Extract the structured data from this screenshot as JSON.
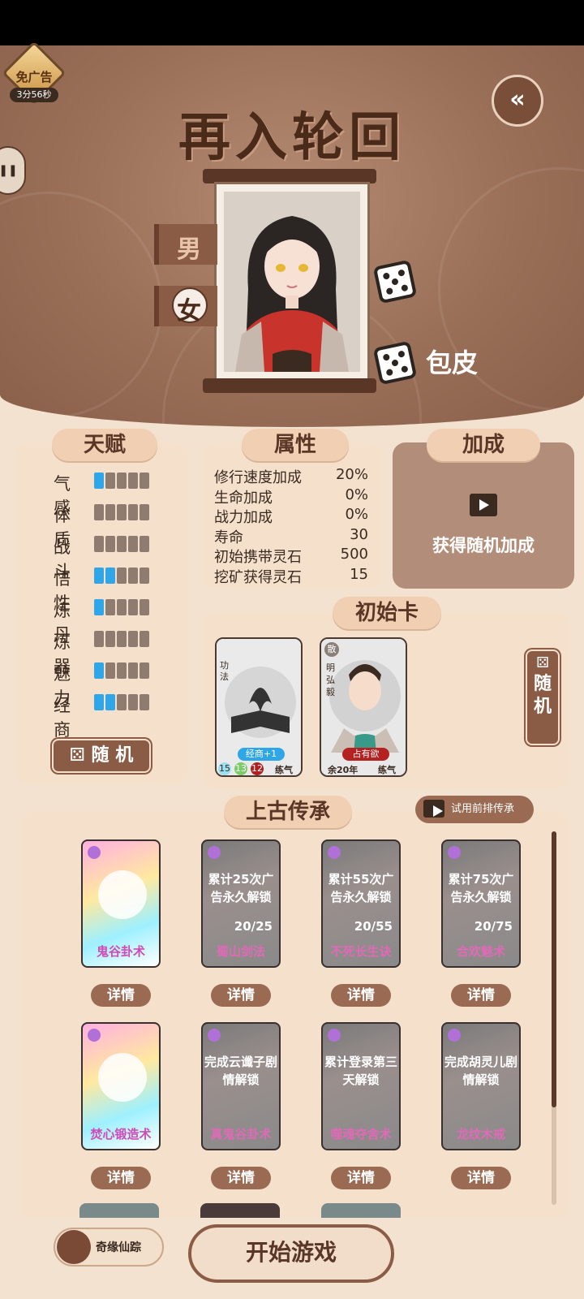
{
  "ad_badge": {
    "label": "免广告",
    "timer": "3分56秒"
  },
  "side_pill": {
    "label": "❚❚"
  },
  "back_button": {
    "glyph": "«"
  },
  "title": "再入轮回",
  "gender": {
    "male": "男",
    "female": "女",
    "selected": "female"
  },
  "skin_label": "包皮",
  "talent": {
    "tab": "天赋",
    "rows": [
      {
        "label": "气感",
        "level": 1
      },
      {
        "label": "体质",
        "level": 0
      },
      {
        "label": "战斗",
        "level": 0
      },
      {
        "label": "悟性",
        "level": 2
      },
      {
        "label": "炼丹",
        "level": 1
      },
      {
        "label": "炼器",
        "level": 0
      },
      {
        "label": "魅力",
        "level": 1
      },
      {
        "label": "经商",
        "level": 2
      }
    ],
    "max_level": 5,
    "random_button": "随 机"
  },
  "attributes": {
    "tab": "属性",
    "rows": [
      {
        "k": "修行速度加成",
        "v": "20%"
      },
      {
        "k": "生命加成",
        "v": "0%"
      },
      {
        "k": "战力加成",
        "v": "0%"
      },
      {
        "k": "寿命",
        "v": "30"
      },
      {
        "k": "初始携带灵石",
        "v": "500"
      },
      {
        "k": "挖矿获得灵石",
        "v": "15"
      }
    ]
  },
  "bonus": {
    "tab": "加成",
    "text": "获得随机加成"
  },
  "initial_cards": {
    "tab": "初始卡",
    "card1": {
      "vertical": "功法",
      "tag": "经商+1",
      "n1": "15",
      "n2": "13",
      "n3": "12",
      "stage": "练气"
    },
    "card2": {
      "badge": "散",
      "vertical": "明弘毅",
      "tag": "占有欲",
      "age": "余20年",
      "stage": "练气"
    },
    "random_vertical": "随机"
  },
  "legacy": {
    "tab": "上古传承",
    "trial_button": "试用前排传承",
    "detail_label": "详情",
    "cards": [
      {
        "name": "鬼谷卦术",
        "locked": false,
        "cond": "",
        "prog": ""
      },
      {
        "name": "蜀山剑法",
        "locked": true,
        "cond": "累计25次广告永久解锁",
        "prog": "20/25"
      },
      {
        "name": "不死长生诀",
        "locked": true,
        "cond": "累计55次广告永久解锁",
        "prog": "20/55"
      },
      {
        "name": "合欢魅术",
        "locked": true,
        "cond": "累计75次广告永久解锁",
        "prog": "20/75"
      },
      {
        "name": "焚心锻造术",
        "locked": false,
        "cond": "",
        "prog": ""
      },
      {
        "name": "真鬼谷卦术",
        "locked": true,
        "cond": "完成云谶子剧情解锁",
        "prog": ""
      },
      {
        "name": "噬魂夺舍术",
        "locked": true,
        "cond": "累计登录第三天解锁",
        "prog": ""
      },
      {
        "name": "龙纹木戒",
        "locked": true,
        "cond": "完成胡灵儿剧情解锁",
        "prog": ""
      }
    ]
  },
  "qiyuan_label": "奇缘仙踪",
  "start_button": "开始游戏",
  "colors": {
    "accent": "#8a5c45",
    "panel": "#f5e0cc",
    "progress_on": "#2ea6e8"
  }
}
